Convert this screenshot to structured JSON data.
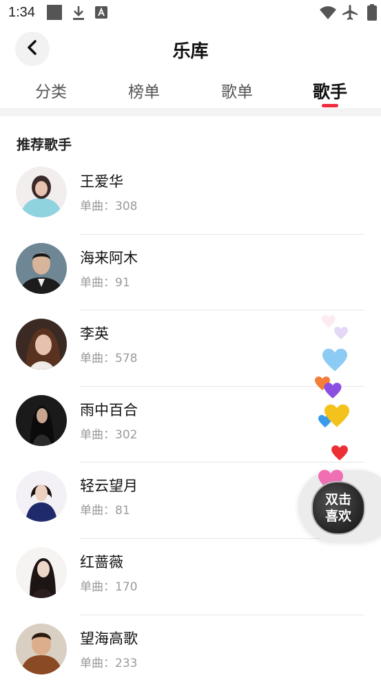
{
  "status_bar": {
    "time": "1:34",
    "icons": [
      "square-notification-icon",
      "download-icon",
      "a-badge-icon",
      "wifi-icon",
      "airplane-icon",
      "battery-icon"
    ]
  },
  "header": {
    "title": "乐库",
    "back_icon": "back-arrow-icon"
  },
  "tabs": [
    {
      "label": "分类",
      "active": false
    },
    {
      "label": "榜单",
      "active": false
    },
    {
      "label": "歌单",
      "active": false
    },
    {
      "label": "歌手",
      "active": true
    }
  ],
  "colors": {
    "accent": "#ef2b3d",
    "secondary_text": "#9a9a9a"
  },
  "section": {
    "title": "推荐歌手"
  },
  "artists": [
    {
      "name": "王爱华",
      "count": "单曲：308"
    },
    {
      "name": "海来阿木",
      "count": "单曲：91"
    },
    {
      "name": "李英",
      "count": "单曲：578"
    },
    {
      "name": "雨中百合",
      "count": "单曲：302"
    },
    {
      "name": "轻云望月",
      "count": "单曲：81"
    },
    {
      "name": "红蔷薇",
      "count": "单曲：170"
    },
    {
      "name": "望海高歌",
      "count": "单曲：233"
    }
  ],
  "like_button": {
    "line1": "双击",
    "line2": "喜欢"
  }
}
